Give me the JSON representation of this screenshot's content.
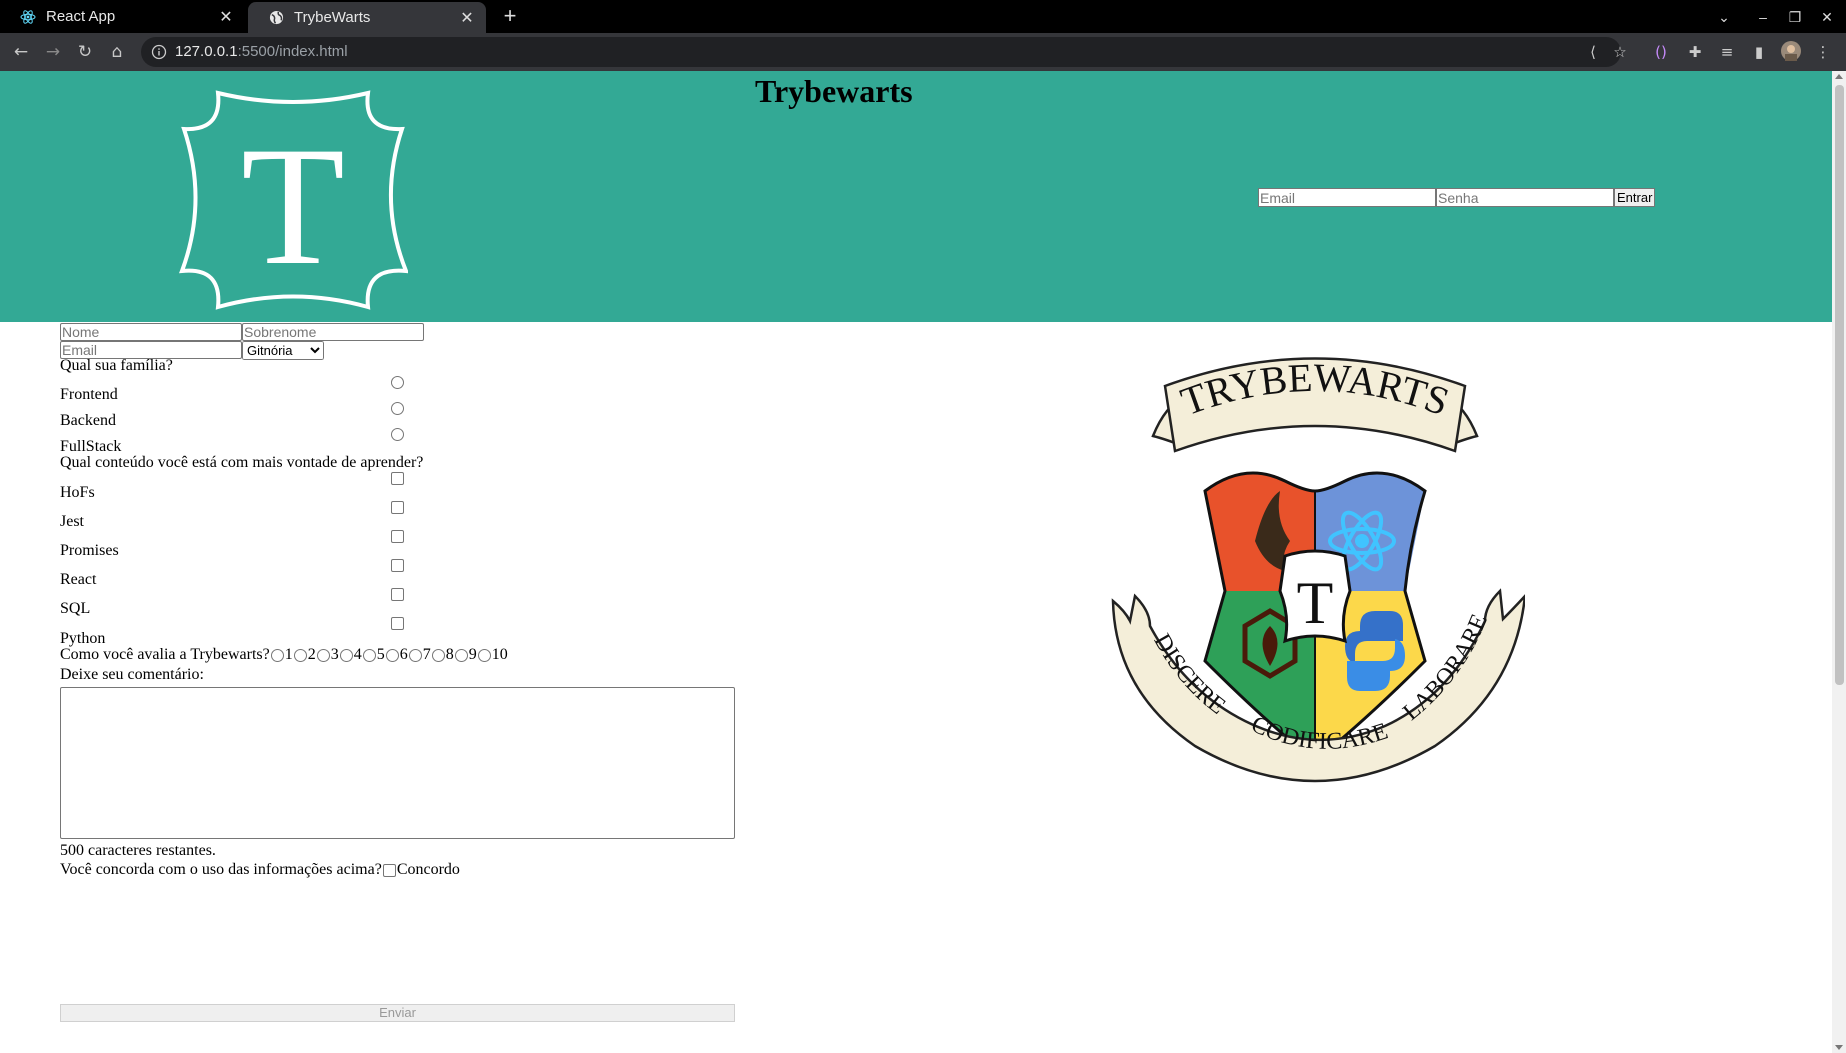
{
  "browser": {
    "tabs": [
      {
        "title": "React App",
        "icon": "react-icon",
        "active": false
      },
      {
        "title": "TrybeWarts",
        "icon": "globe-icon",
        "active": true
      }
    ],
    "url_host": "127.0.0.1",
    "url_rest": ":5500/index.html"
  },
  "header": {
    "title": "Trybewarts",
    "logo_letter": "T",
    "login": {
      "email_placeholder": "Email",
      "password_placeholder": "Senha",
      "button": "Entrar"
    },
    "background_color": "#33a995"
  },
  "form": {
    "name_placeholder": "Nome",
    "lastname_placeholder": "Sobrenome",
    "email_placeholder": "Email",
    "house_selected": "Gitnória",
    "family_question": "Qual sua família?",
    "families": [
      "Frontend",
      "Backend",
      "FullStack"
    ],
    "content_question": "Qual conteúdo você está com mais vontade de aprender?",
    "contents": [
      "HoFs",
      "Jest",
      "Promises",
      "React",
      "SQL",
      "Python"
    ],
    "rating_question": "Como você avalia a Trybewarts?",
    "ratings": [
      "1",
      "2",
      "3",
      "4",
      "5",
      "6",
      "7",
      "8",
      "9",
      "10"
    ],
    "comment_label": "Deixe seu comentário:",
    "counter": "500 caracteres restantes.",
    "agreement_question": "Você concorda com o uso das informações acima?",
    "agreement_label": "Concordo",
    "submit": "Enviar"
  },
  "crest": {
    "banner_top": "TRYBEWARTS",
    "center_letter": "T",
    "motto_left": "DISCERE",
    "motto_center": "CODIFICARE",
    "motto_right": "LABORARE"
  }
}
